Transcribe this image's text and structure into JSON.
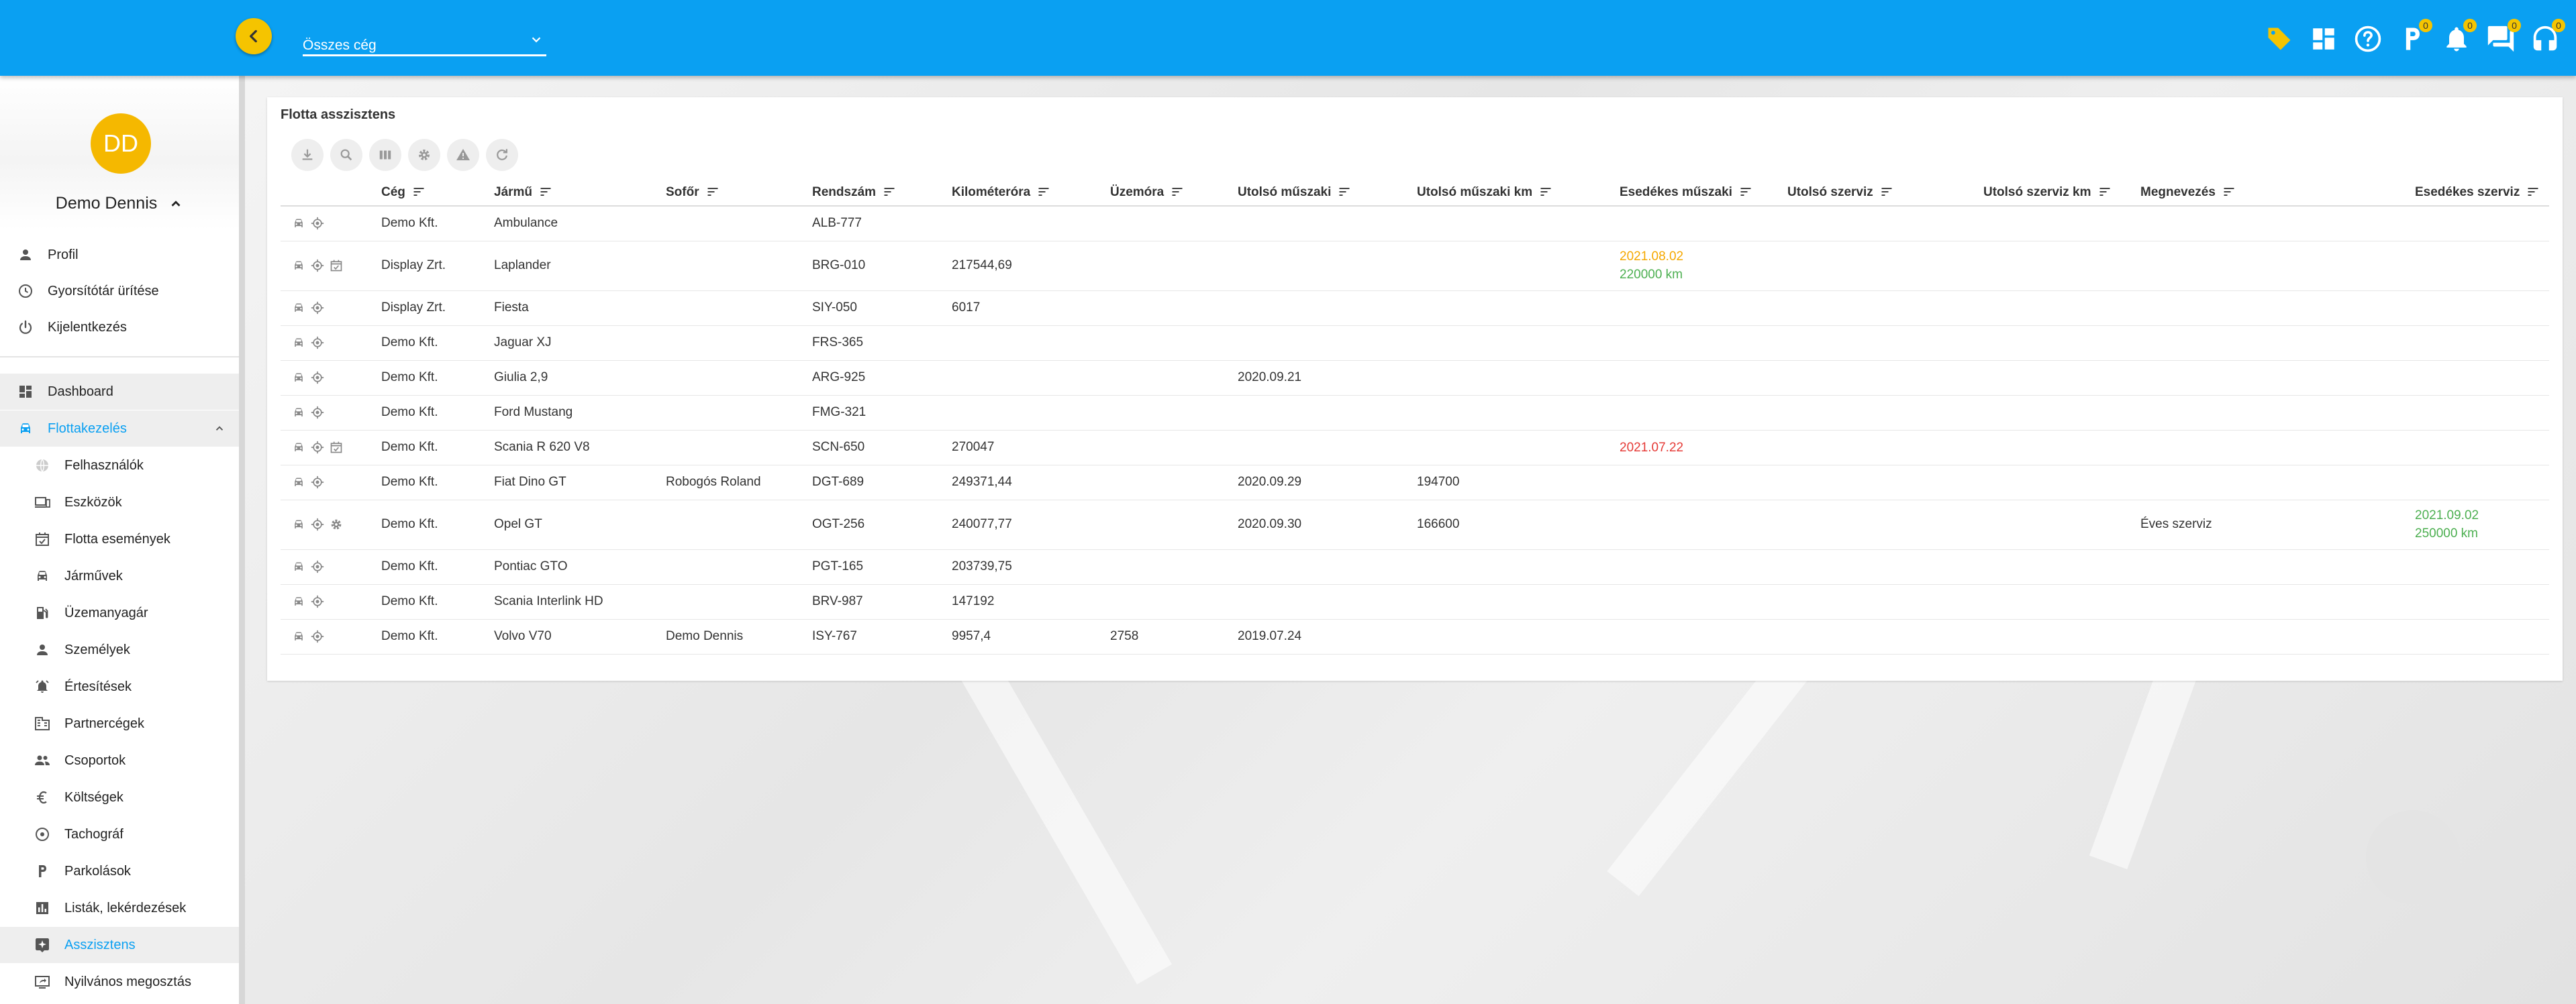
{
  "colors": {
    "primary": "#0aa0f2",
    "accent": "#f5c400",
    "active_text": "#0aa0f2",
    "due_warning": "#f5a800",
    "due_ok": "#4caf50",
    "due_overdue": "#e53935"
  },
  "header": {
    "company_select": {
      "value": "Összes cég"
    },
    "icons": [
      {
        "name": "tag-icon",
        "badge": null
      },
      {
        "name": "dashboard-grid-icon",
        "badge": null
      },
      {
        "name": "help-icon",
        "badge": null
      },
      {
        "name": "parking-icon",
        "badge": "0"
      },
      {
        "name": "bell-icon",
        "badge": "0"
      },
      {
        "name": "chat-icon",
        "badge": "0"
      },
      {
        "name": "headset-icon",
        "badge": "0"
      }
    ]
  },
  "sidebar": {
    "avatar_initials": "DD",
    "user_name": "Demo Dennis",
    "account_items": [
      {
        "label": "Profil",
        "icon": "person-icon"
      },
      {
        "label": "Gyorsítótár ürítése",
        "icon": "clock-icon"
      },
      {
        "label": "Kijelentkezés",
        "icon": "power-icon"
      }
    ],
    "nav": [
      {
        "label": "Dashboard",
        "icon": "dashboard-icon"
      },
      {
        "label": "Flottakezelés",
        "icon": "car-icon"
      }
    ],
    "sub_items": [
      {
        "label": "Felhasználók",
        "icon": "users-globe-icon"
      },
      {
        "label": "Eszközök",
        "icon": "devices-icon"
      },
      {
        "label": "Flotta események",
        "icon": "calendar-check-icon"
      },
      {
        "label": "Járművek",
        "icon": "car-icon"
      },
      {
        "label": "Üzemanyagár",
        "icon": "fuel-icon"
      },
      {
        "label": "Személyek",
        "icon": "person-icon"
      },
      {
        "label": "Értesítések",
        "icon": "alarm-icon"
      },
      {
        "label": "Partnercégek",
        "icon": "business-icon"
      },
      {
        "label": "Csoportok",
        "icon": "group-icon"
      },
      {
        "label": "Költségek",
        "icon": "euro-icon"
      },
      {
        "label": "Tachográf",
        "icon": "tachograph-icon"
      },
      {
        "label": "Parkolások",
        "icon": "parking-icon"
      },
      {
        "label": "Listák, lekérdezések",
        "icon": "bar-chart-icon"
      },
      {
        "label": "Asszisztens",
        "icon": "assistant-icon"
      },
      {
        "label": "Nyilvános megosztás",
        "icon": "share-screen-icon"
      }
    ]
  },
  "panel": {
    "title": "Flotta asszisztens",
    "toolbar": [
      {
        "name": "download-icon"
      },
      {
        "name": "search-icon"
      },
      {
        "name": "columns-icon"
      },
      {
        "name": "settings-icon"
      },
      {
        "name": "warning-icon"
      },
      {
        "name": "refresh-icon"
      }
    ],
    "columns": [
      "Cég",
      "Jármű",
      "Sofőr",
      "Rendszám",
      "Kilométeróra",
      "Üzemóra",
      "Utolsó műszaki",
      "Utolsó műszaki km",
      "Esedékes műszaki",
      "Utolsó szerviz",
      "Utolsó szerviz km",
      "Megnevezés",
      "Esedékes szerviz"
    ],
    "rows": [
      {
        "icons": [
          "car",
          "target"
        ],
        "ceg": "Demo Kft.",
        "jarmu": "Ambulance",
        "sofor": "",
        "rendszam": "ALB-777",
        "km": "",
        "uzemora": "",
        "utolso_muszaki": "",
        "utolso_muszaki_km": "",
        "esedekes_muszaki": "",
        "esedekes_muszaki_2": "",
        "esedekes_muszaki_color": "",
        "utolso_szerviz": "",
        "utolso_szerviz_km": "",
        "megnevezes": "",
        "esedekes_szerviz": "",
        "esedekes_szerviz_2": ""
      },
      {
        "icons": [
          "car",
          "target",
          "calendar"
        ],
        "ceg": "Display Zrt.",
        "jarmu": "Laplander",
        "sofor": "",
        "rendszam": "BRG-010",
        "km": "217544,69",
        "uzemora": "",
        "utolso_muszaki": "",
        "utolso_muszaki_km": "",
        "esedekes_muszaki": "2021.08.02",
        "esedekes_muszaki_2": "220000 km",
        "esedekes_muszaki_color": "orange-green",
        "utolso_szerviz": "",
        "utolso_szerviz_km": "",
        "megnevezes": "",
        "esedekes_szerviz": "",
        "esedekes_szerviz_2": ""
      },
      {
        "icons": [
          "car",
          "target"
        ],
        "ceg": "Display Zrt.",
        "jarmu": "Fiesta",
        "sofor": "",
        "rendszam": "SIY-050",
        "km": "6017",
        "uzemora": "",
        "utolso_muszaki": "",
        "utolso_muszaki_km": "",
        "esedekes_muszaki": "",
        "esedekes_muszaki_2": "",
        "esedekes_muszaki_color": "",
        "utolso_szerviz": "",
        "utolso_szerviz_km": "",
        "megnevezes": "",
        "esedekes_szerviz": "",
        "esedekes_szerviz_2": ""
      },
      {
        "icons": [
          "car",
          "target"
        ],
        "ceg": "Demo Kft.",
        "jarmu": "Jaguar XJ",
        "sofor": "",
        "rendszam": "FRS-365",
        "km": "",
        "uzemora": "",
        "utolso_muszaki": "",
        "utolso_muszaki_km": "",
        "esedekes_muszaki": "",
        "esedekes_muszaki_2": "",
        "esedekes_muszaki_color": "",
        "utolso_szerviz": "",
        "utolso_szerviz_km": "",
        "megnevezes": "",
        "esedekes_szerviz": "",
        "esedekes_szerviz_2": ""
      },
      {
        "icons": [
          "car",
          "target"
        ],
        "ceg": "Demo Kft.",
        "jarmu": "Giulia 2,9",
        "sofor": "",
        "rendszam": "ARG-925",
        "km": "",
        "uzemora": "",
        "utolso_muszaki": "2020.09.21",
        "utolso_muszaki_km": "",
        "esedekes_muszaki": "",
        "esedekes_muszaki_2": "",
        "esedekes_muszaki_color": "",
        "utolso_szerviz": "",
        "utolso_szerviz_km": "",
        "megnevezes": "",
        "esedekes_szerviz": "",
        "esedekes_szerviz_2": ""
      },
      {
        "icons": [
          "car",
          "target"
        ],
        "ceg": "Demo Kft.",
        "jarmu": "Ford Mustang",
        "sofor": "",
        "rendszam": "FMG-321",
        "km": "",
        "uzemora": "",
        "utolso_muszaki": "",
        "utolso_muszaki_km": "",
        "esedekes_muszaki": "",
        "esedekes_muszaki_2": "",
        "esedekes_muszaki_color": "",
        "utolso_szerviz": "",
        "utolso_szerviz_km": "",
        "megnevezes": "",
        "esedekes_szerviz": "",
        "esedekes_szerviz_2": ""
      },
      {
        "icons": [
          "car",
          "target",
          "calendar"
        ],
        "ceg": "Demo Kft.",
        "jarmu": "Scania R 620 V8",
        "sofor": "",
        "rendszam": "SCN-650",
        "km": "270047",
        "uzemora": "",
        "utolso_muszaki": "",
        "utolso_muszaki_km": "",
        "esedekes_muszaki": "2021.07.22",
        "esedekes_muszaki_2": "",
        "esedekes_muszaki_color": "red",
        "utolso_szerviz": "",
        "utolso_szerviz_km": "",
        "megnevezes": "",
        "esedekes_szerviz": "",
        "esedekes_szerviz_2": ""
      },
      {
        "icons": [
          "car",
          "target"
        ],
        "ceg": "Demo Kft.",
        "jarmu": "Fiat Dino GT",
        "sofor": "Robogós Roland",
        "rendszam": "DGT-689",
        "km": "249371,44",
        "uzemora": "",
        "utolso_muszaki": "2020.09.29",
        "utolso_muszaki_km": "194700",
        "esedekes_muszaki": "",
        "esedekes_muszaki_2": "",
        "esedekes_muszaki_color": "",
        "utolso_szerviz": "",
        "utolso_szerviz_km": "",
        "megnevezes": "",
        "esedekes_szerviz": "",
        "esedekes_szerviz_2": ""
      },
      {
        "icons": [
          "car",
          "target",
          "gear"
        ],
        "ceg": "Demo Kft.",
        "jarmu": "Opel GT",
        "sofor": "",
        "rendszam": "OGT-256",
        "km": "240077,77",
        "uzemora": "",
        "utolso_muszaki": "2020.09.30",
        "utolso_muszaki_km": "166600",
        "esedekes_muszaki": "",
        "esedekes_muszaki_2": "",
        "esedekes_muszaki_color": "",
        "utolso_szerviz": "",
        "utolso_szerviz_km": "",
        "megnevezes": "Éves szerviz",
        "esedekes_szerviz": "2021.09.02",
        "esedekes_szerviz_2": "250000 km"
      },
      {
        "icons": [
          "car",
          "target"
        ],
        "ceg": "Demo Kft.",
        "jarmu": "Pontiac GTO",
        "sofor": "",
        "rendszam": "PGT-165",
        "km": "203739,75",
        "uzemora": "",
        "utolso_muszaki": "",
        "utolso_muszaki_km": "",
        "esedekes_muszaki": "",
        "esedekes_muszaki_2": "",
        "esedekes_muszaki_color": "",
        "utolso_szerviz": "",
        "utolso_szerviz_km": "",
        "megnevezes": "",
        "esedekes_szerviz": "",
        "esedekes_szerviz_2": ""
      },
      {
        "icons": [
          "car",
          "target"
        ],
        "ceg": "Demo Kft.",
        "jarmu": "Scania Interlink HD",
        "sofor": "",
        "rendszam": "BRV-987",
        "km": "147192",
        "uzemora": "",
        "utolso_muszaki": "",
        "utolso_muszaki_km": "",
        "esedekes_muszaki": "",
        "esedekes_muszaki_2": "",
        "esedekes_muszaki_color": "",
        "utolso_szerviz": "",
        "utolso_szerviz_km": "",
        "megnevezes": "",
        "esedekes_szerviz": "",
        "esedekes_szerviz_2": ""
      },
      {
        "icons": [
          "car",
          "target"
        ],
        "ceg": "Demo Kft.",
        "jarmu": "Volvo V70",
        "sofor": "Demo Dennis",
        "rendszam": "ISY-767",
        "km": "9957,4",
        "uzemora": "2758",
        "utolso_muszaki": "2019.07.24",
        "utolso_muszaki_km": "",
        "esedekes_muszaki": "",
        "esedekes_muszaki_2": "",
        "esedekes_muszaki_color": "",
        "utolso_szerviz": "",
        "utolso_szerviz_km": "",
        "megnevezes": "",
        "esedekes_szerviz": "",
        "esedekes_szerviz_2": ""
      }
    ]
  }
}
